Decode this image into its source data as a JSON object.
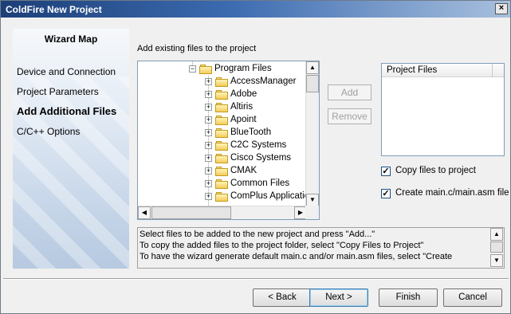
{
  "window": {
    "title": "ColdFire New Project",
    "close_glyph": "×"
  },
  "wizard_map": {
    "title": "Wizard Map",
    "items": [
      {
        "label": "Device and Connection",
        "active": false
      },
      {
        "label": "Project Parameters",
        "active": false
      },
      {
        "label": "Add Additional Files",
        "active": true
      },
      {
        "label": "C/C++ Options",
        "active": false
      }
    ]
  },
  "main": {
    "section_label": "Add existing files to the project",
    "tree": {
      "root": "Program Files",
      "children": [
        "AccessManager",
        "Adobe",
        "Altiris",
        "Apoint",
        "BlueTooth",
        "C2C Systems",
        "Cisco Systems",
        "CMAK",
        "Common Files",
        "ComPlus Application"
      ],
      "expander_expanded": "−",
      "expander_collapsed": "+",
      "icon": "folder-icon"
    },
    "add_button": "Add",
    "remove_button": "Remove",
    "project_files_header": "Project Files",
    "options": [
      {
        "label": "Copy files to project",
        "checked": true
      },
      {
        "label": "Create main.c/main.asm file",
        "checked": true
      }
    ],
    "check_glyph": "✓",
    "info_lines": [
      "Select files to be added to the new project and press \"Add...\"",
      "To copy the added files to the project folder, select \"Copy Files to Project\"",
      "To have the wizard generate default main.c and/or main.asm files, select \"Create"
    ]
  },
  "footer": {
    "back": "< Back",
    "next": "Next >",
    "finish": "Finish",
    "cancel": "Cancel"
  },
  "glyphs": {
    "up": "▲",
    "down": "▼",
    "left": "◀",
    "right": "▶"
  }
}
